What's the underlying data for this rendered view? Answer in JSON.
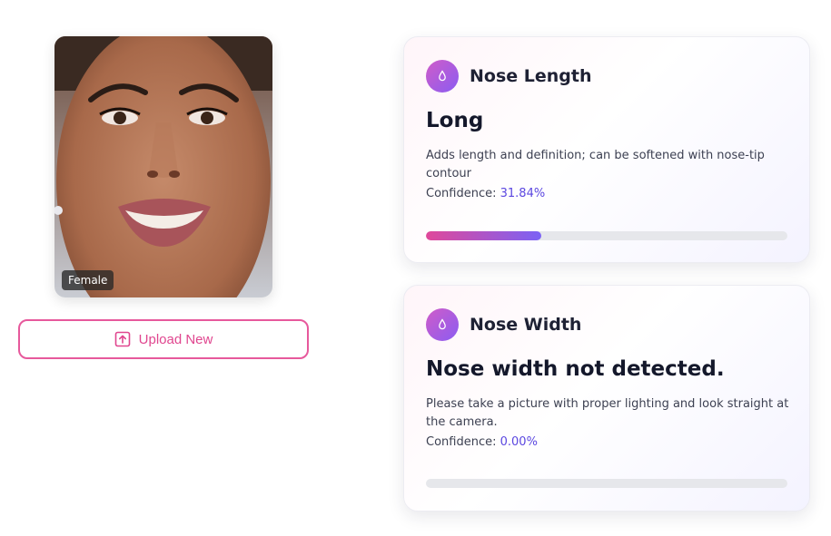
{
  "photo": {
    "gender_label": "Female"
  },
  "upload": {
    "label": "Upload New",
    "icon": "upload-icon"
  },
  "cards": [
    {
      "title": "Nose Length",
      "icon": "droplet-icon",
      "result": "Long",
      "description": "Adds length and definition; can be softened with nose-tip contour",
      "confidence_label": "Confidence:",
      "confidence_value": "31.84%",
      "confidence_fraction": 0.3184
    },
    {
      "title": "Nose Width",
      "icon": "droplet-icon",
      "result": "Nose width not detected.",
      "description": "Please take a picture with proper lighting and look straight at the camera.",
      "confidence_label": "Confidence:",
      "confidence_value": "0.00%",
      "confidence_fraction": 0.0
    }
  ],
  "colors": {
    "accent_pink": "#e7599c",
    "accent_purple": "#5b47e0",
    "bar_start": "#e0489a",
    "bar_end": "#7b62f5"
  }
}
